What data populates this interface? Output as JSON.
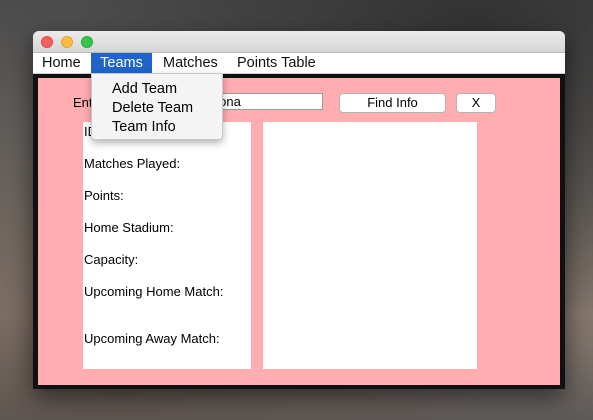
{
  "menubar": {
    "items": [
      {
        "label": "Home"
      },
      {
        "label": "Teams"
      },
      {
        "label": "Matches"
      },
      {
        "label": "Points Table"
      }
    ]
  },
  "teams_menu": {
    "items": [
      {
        "label": "Add Team"
      },
      {
        "label": "Delete Team"
      },
      {
        "label": "Team Info"
      }
    ]
  },
  "search": {
    "label_visible": "Ente",
    "input_value_visible": "elona"
  },
  "buttons": {
    "find_info": "Find Info",
    "close": "X"
  },
  "info": {
    "id_visible": "ID",
    "matches_played": "Matches Played:",
    "points": "Points:",
    "home_stadium": "Home Stadium:",
    "capacity": "Capacity:",
    "upcoming_home": "Upcoming Home Match:",
    "upcoming_away": "Upcoming Away Match:"
  },
  "colors": {
    "panel_background": "#ffadb1",
    "active_menu": "#1f65c9"
  }
}
